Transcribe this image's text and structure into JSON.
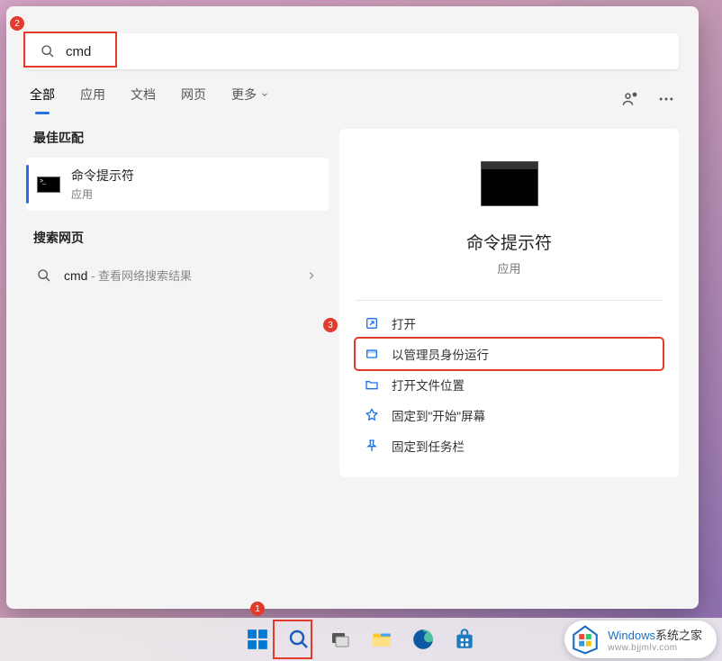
{
  "search": {
    "value": "cmd",
    "placeholder": ""
  },
  "tabs": {
    "all": "全部",
    "apps": "应用",
    "docs": "文档",
    "web": "网页",
    "more": "更多"
  },
  "left": {
    "best_match_label": "最佳匹配",
    "best_match_title": "命令提示符",
    "best_match_sub": "应用",
    "web_search_label": "搜索网页",
    "web_item_query": "cmd",
    "web_item_suffix": " - 查看网络搜索结果"
  },
  "preview": {
    "title": "命令提示符",
    "sub": "应用",
    "actions": [
      "打开",
      "以管理员身份运行",
      "打开文件位置",
      "固定到\"开始\"屏幕",
      "固定到任务栏"
    ]
  },
  "annotations": {
    "a1": "1",
    "a2": "2",
    "a3": "3"
  },
  "watermark": {
    "brand1": "Windows",
    "brand2": "系统之家",
    "url": "www.bjjmlv.com"
  }
}
